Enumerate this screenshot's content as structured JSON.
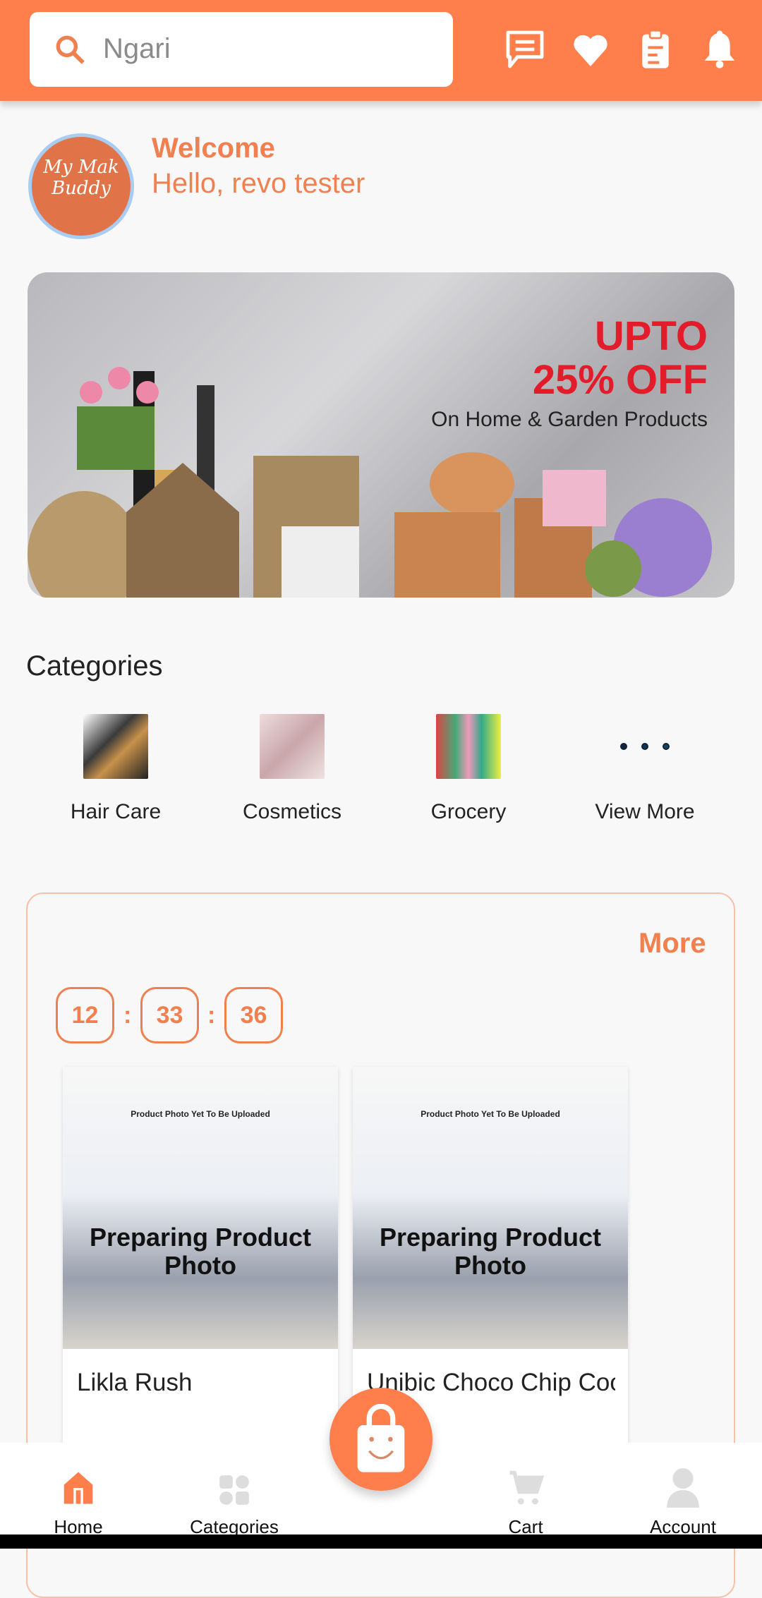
{
  "colors": {
    "brand": "#fe7e4c",
    "text": "#222222"
  },
  "header": {
    "search_value": "Ngari",
    "icons": [
      "chat-icon",
      "heart-icon",
      "clipboard-icon",
      "bell-icon"
    ]
  },
  "greeting": {
    "logo_text": "My Mak Buddy",
    "welcome": "Welcome",
    "hello": "Hello, revo tester"
  },
  "banner": {
    "line1": "UPTO",
    "line2": "25% OFF",
    "line3": "On Home & Garden Products"
  },
  "categories": {
    "title": "Categories",
    "items": [
      {
        "label": "Hair Care"
      },
      {
        "label": "Cosmetics"
      },
      {
        "label": "Grocery"
      },
      {
        "label": "View More"
      }
    ]
  },
  "flash": {
    "more": "More",
    "timer": [
      "12",
      "33",
      "36"
    ],
    "separator": ":",
    "products": [
      {
        "placeholder_small": "Product Photo Yet To Be Uploaded",
        "placeholder_big": "Preparing Product Photo",
        "name": "Likla Rush"
      },
      {
        "placeholder_small": "Product Photo Yet To Be Uploaded",
        "placeholder_big": "Preparing Product Photo",
        "name": "Unibic Choco Chip Cookies"
      }
    ]
  },
  "nav": {
    "items": [
      {
        "label": "Home",
        "active": true
      },
      {
        "label": "Categories"
      },
      {
        "label": "Cart"
      },
      {
        "label": "Account"
      }
    ]
  }
}
